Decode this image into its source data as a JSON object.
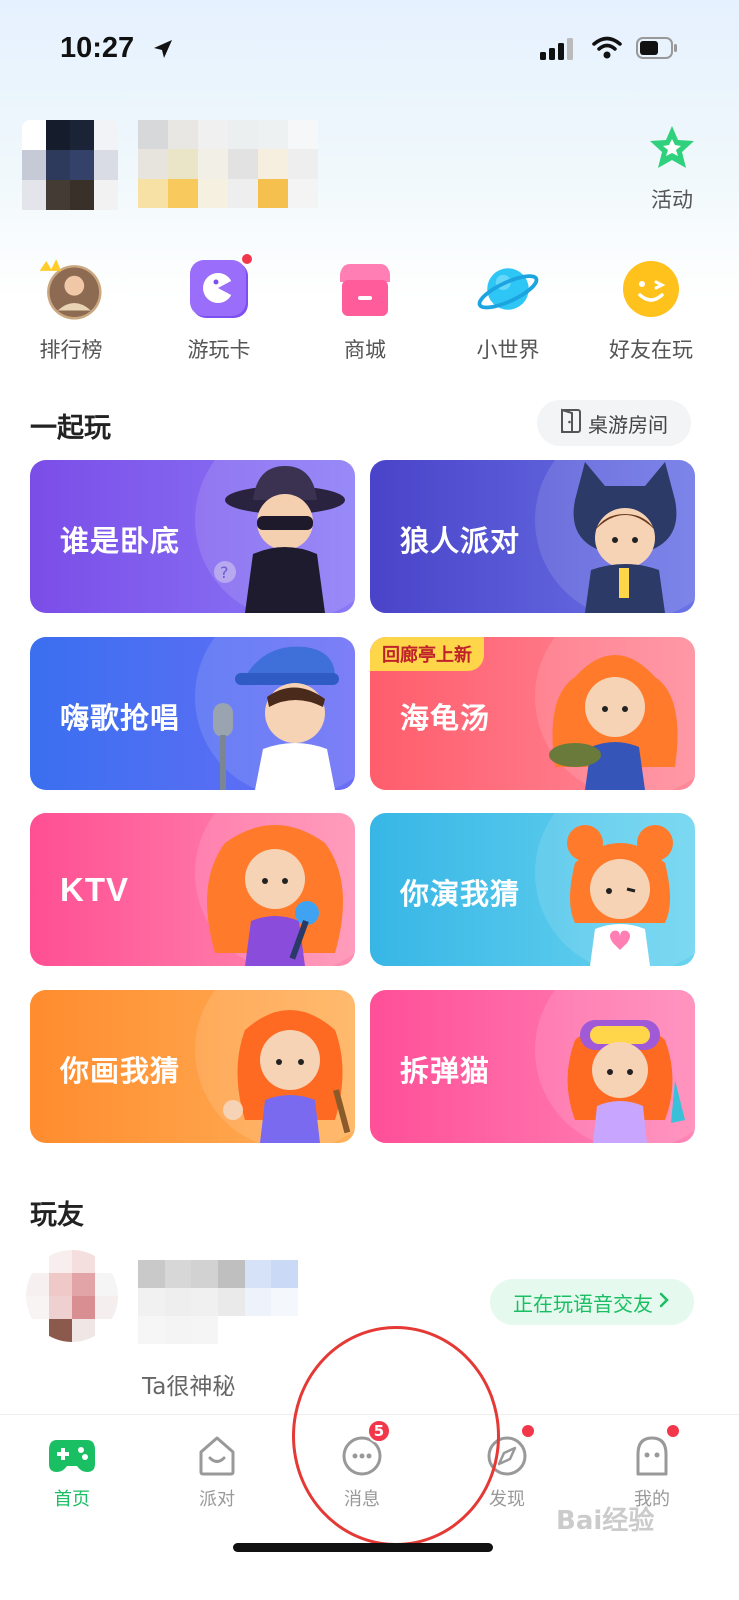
{
  "status_bar": {
    "time": "10:27"
  },
  "header": {
    "activity_label": "活动"
  },
  "quick_entries": [
    {
      "label": "排行榜",
      "icon": "ranking-avatar-icon"
    },
    {
      "label": "游玩卡",
      "icon": "play-card-icon"
    },
    {
      "label": "商城",
      "icon": "store-icon"
    },
    {
      "label": "小世界",
      "icon": "planet-icon"
    },
    {
      "label": "好友在玩",
      "icon": "friends-playing-icon"
    }
  ],
  "play_together": {
    "title": "一起玩",
    "room_button": "桌游房间",
    "games": [
      {
        "label": "谁是卧底",
        "color_from": "#7b4de8",
        "color_to": "#8a7af7"
      },
      {
        "label": "狼人派对",
        "color_from": "#4a43c9",
        "color_to": "#6a74e6"
      },
      {
        "label": "嗨歌抢唱",
        "color_from": "#3a6ff0",
        "color_to": "#6b6ef6"
      },
      {
        "label": "海龟汤",
        "color_from": "#ff5d6c",
        "color_to": "#ff8a9a",
        "tag": "回廊亭上新"
      },
      {
        "label": "KTV",
        "color_from": "#ff4f93",
        "color_to": "#ff8fb3"
      },
      {
        "label": "你演我猜",
        "color_from": "#37b6e6",
        "color_to": "#6ad4ef"
      },
      {
        "label": "你画我猜",
        "color_from": "#ff8c2e",
        "color_to": "#ffb15a"
      },
      {
        "label": "拆弹猫",
        "color_from": "#ff4f98",
        "color_to": "#ff86b7"
      }
    ]
  },
  "friends": {
    "title": "玩友",
    "playing_label": "正在玩语音交友",
    "subtitle": "Ta很神秘"
  },
  "tabbar": {
    "tabs": [
      {
        "label": "首页",
        "active": true
      },
      {
        "label": "派对"
      },
      {
        "label": "消息",
        "badge": "5"
      },
      {
        "label": "发现",
        "dot": true
      },
      {
        "label": "我的",
        "dot": true
      }
    ]
  },
  "watermark": "Bai经验",
  "colors": {
    "accent": "#1bbf63",
    "badge": "#f2374b"
  }
}
